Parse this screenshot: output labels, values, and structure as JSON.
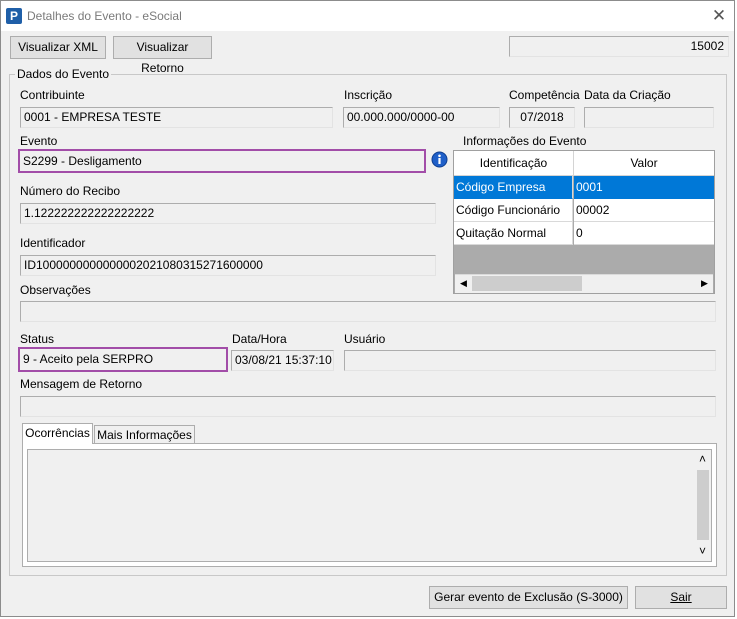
{
  "window": {
    "title": "Detalhes do Evento - eSocial",
    "close_glyph": "✕",
    "app_icon_glyph": "P"
  },
  "toolbar": {
    "view_xml_label": "Visualizar XML",
    "view_return_label": "Visualizar Retorno",
    "counter_value": "15002"
  },
  "group": {
    "title": "Dados do Evento"
  },
  "fields": {
    "contribuinte_label": "Contribuinte",
    "contribuinte_value": "0001 - EMPRESA TESTE",
    "inscricao_label": "Inscrição",
    "inscricao_value": "00.000.000/0000-00",
    "competencia_label": "Competência",
    "competencia_value": "07/2018",
    "data_criacao_label": "Data da Criação",
    "data_criacao_value": "",
    "evento_label": "Evento",
    "evento_value": "S2299 - Desligamento",
    "numero_recibo_label": "Número do Recibo",
    "numero_recibo_value": "1.122222222222222222",
    "identificador_label": "Identificador",
    "identificador_value": "ID1000000000000002021080315271600000",
    "observacoes_label": "Observações",
    "observacoes_value": "",
    "status_label": "Status",
    "status_value": "9 - Aceito pela SERPRO",
    "datahora_label": "Data/Hora",
    "datahora_value": "03/08/21 15:37:10",
    "usuario_label": "Usuário",
    "usuario_value": "",
    "mensagem_retorno_label": "Mensagem de Retorno",
    "mensagem_retorno_value": ""
  },
  "info_grid": {
    "title": "Informações do Evento",
    "columns": [
      "Identificação",
      "Valor"
    ],
    "rows": [
      {
        "id": "Código Empresa",
        "valor": "0001"
      },
      {
        "id": "Código Funcionário",
        "valor": "00002"
      },
      {
        "id": "Quitação Normal",
        "valor": "0"
      }
    ],
    "selected_row": 0
  },
  "tabs": {
    "items": [
      "Ocorrências",
      "Mais Informações"
    ],
    "active": 0
  },
  "footer": {
    "exclusion_button_label": "Gerar evento de Exclusão (S-3000)",
    "exit_button_label": "Sair"
  },
  "colors": {
    "highlight_border": "#a24da8",
    "selection": "#0078d7",
    "info_icon": "#1f5fc8"
  },
  "icons": {
    "info": "info-icon",
    "scroll_left": "◀",
    "scroll_right": "▶",
    "scroll_up": "˄",
    "scroll_down": "˅"
  }
}
